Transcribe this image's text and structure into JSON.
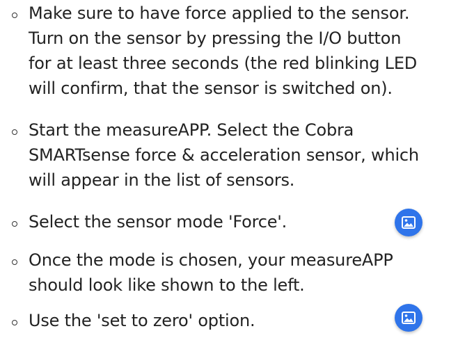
{
  "steps": [
    {
      "lines": [
        "Make sure to have force applied to the sensor.",
        "Turn on the sensor by pressing the I/O button",
        "for at least three seconds (the red blinking LED",
        "will confirm, that the sensor is switched on)."
      ],
      "has_image_button": false
    },
    {
      "lines": [
        "Start the measureAPP. Select the Cobra",
        "SMARTsense force & acceleration sensor, which",
        "will appear in the list of sensors."
      ],
      "has_image_button": false
    },
    {
      "lines": [
        "Select the sensor mode 'Force'."
      ],
      "has_image_button": true,
      "image_button_icon": "image-icon"
    },
    {
      "lines": [
        "Once the mode is chosen, your measureAPP",
        "should look like shown to the left."
      ],
      "has_image_button": false
    },
    {
      "lines": [
        "Use the 'set to zero' option."
      ],
      "has_image_button": true,
      "image_button_icon": "image-icon"
    }
  ],
  "colors": {
    "text": "#222222",
    "bullet": "#333333",
    "image_button": "#2f74ea"
  }
}
